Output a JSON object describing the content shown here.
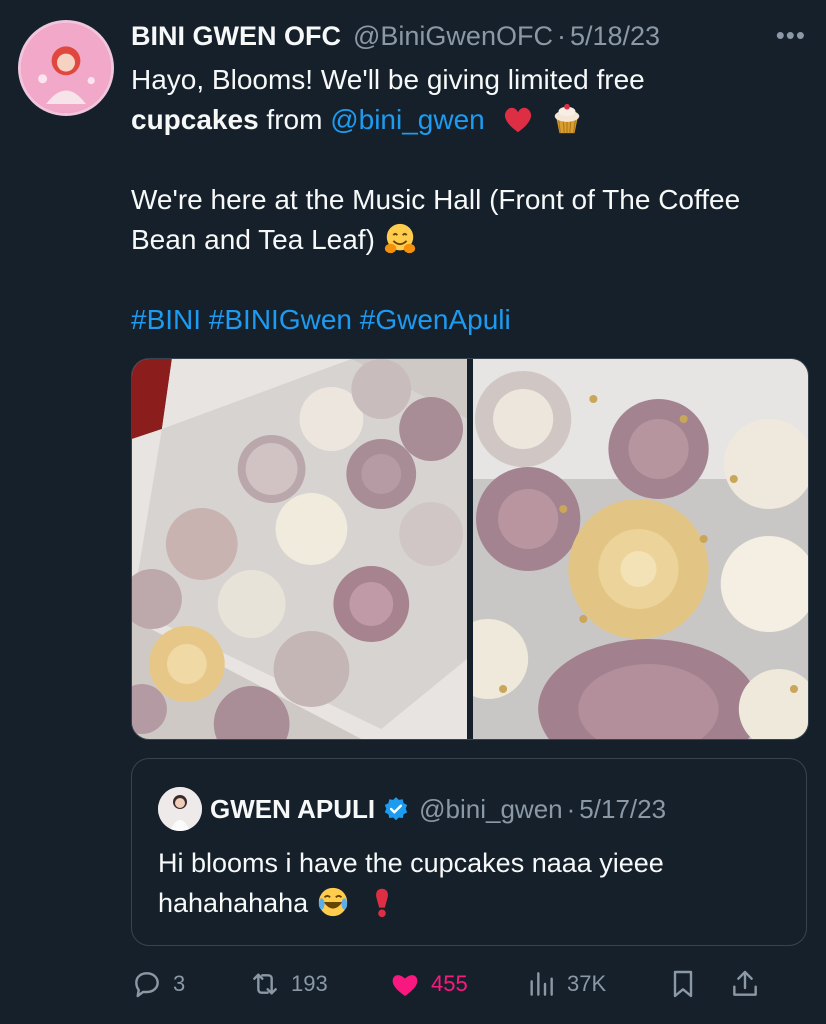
{
  "tweet": {
    "display_name": "BINI GWEN OFC",
    "handle": "@BiniGwenOFC",
    "separator": "·",
    "date": "5/18/23",
    "more_label": "•••",
    "line1": "Hayo, Blooms! We'll be giving limited free",
    "line2_bold": "cupcakes",
    "line2_rest": " from ",
    "mention": "@bini_gwen",
    "para2": "We're here at the Music Hall (Front of The Coffee Bean and Tea Leaf)",
    "hashtags": "#BINI #BINIGwen #GwenApuli"
  },
  "quote": {
    "display_name": "GWEN APULI",
    "handle": "@bini_gwen",
    "separator": "·",
    "date": "5/17/23",
    "text": "Hi blooms i have the cupcakes naaa yieee hahahahaha"
  },
  "actions": {
    "replies": "3",
    "retweets": "193",
    "likes": "455",
    "views": "37K"
  },
  "colors": {
    "background": "#15202b",
    "link": "#1d9bf0",
    "muted": "#8b98a5",
    "like": "#f91880",
    "border": "#38444d"
  },
  "icons": [
    "more-icon",
    "heart-emoji-icon",
    "cupcake-emoji-icon",
    "hug-emoji-icon",
    "verified-icon",
    "laugh-emoji-icon",
    "exclamation-emoji-icon",
    "reply-icon",
    "retweet-icon",
    "like-icon",
    "views-icon",
    "bookmark-icon",
    "share-icon"
  ]
}
